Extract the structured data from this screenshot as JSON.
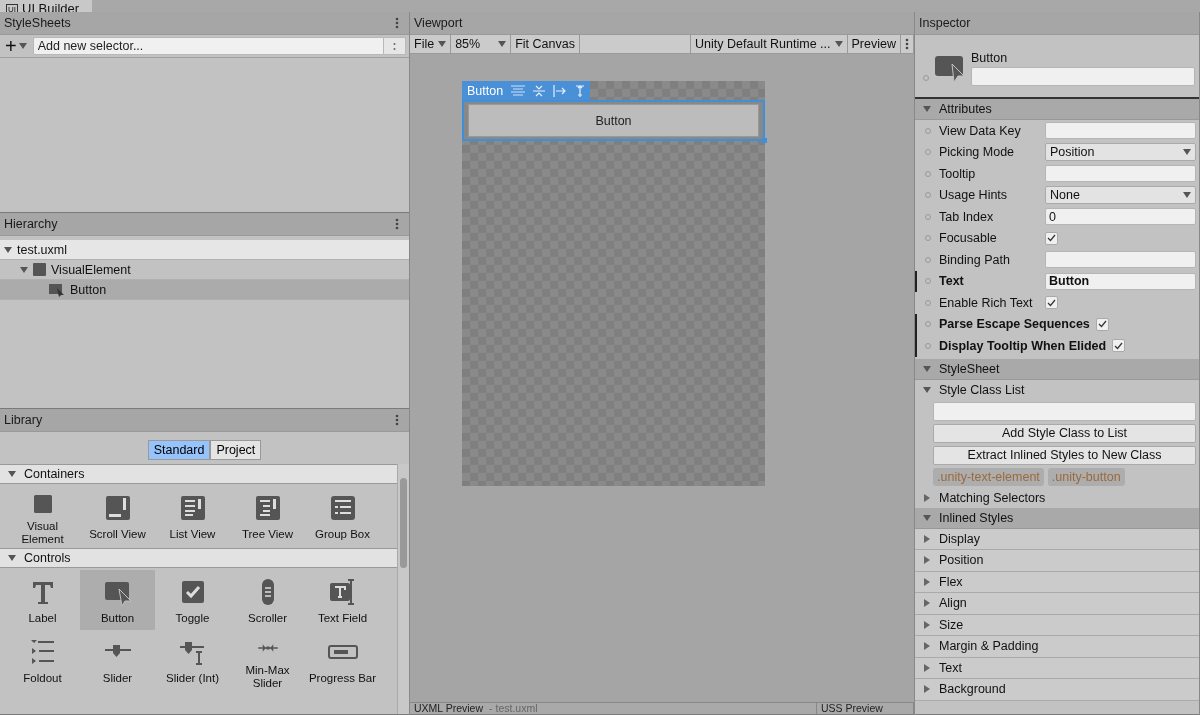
{
  "window": {
    "tab_icon": "UI",
    "title": "UI Builder"
  },
  "stylesheets": {
    "title": "StyleSheets",
    "add_button": "+",
    "selector_field": {
      "placeholder": "Add new selector..."
    }
  },
  "hierarchy": {
    "title": "Hierarchy",
    "items": [
      {
        "label": "test.uxml",
        "kind": "document",
        "expanded": true,
        "selected": false,
        "children": [
          {
            "label": "VisualElement",
            "kind": "element",
            "expanded": true,
            "selected": false,
            "children": [
              {
                "label": "Button",
                "kind": "button",
                "selected": true
              }
            ]
          }
        ]
      }
    ]
  },
  "library": {
    "title": "Library",
    "tabs": [
      {
        "label": "Standard",
        "selected": true
      },
      {
        "label": "Project",
        "selected": false
      }
    ],
    "sections": [
      {
        "title": "Containers",
        "expanded": true,
        "items": [
          {
            "label": "Visual Element",
            "kind": "square",
            "selected": false
          },
          {
            "label": "Scroll View",
            "kind": "scroll",
            "selected": false
          },
          {
            "label": "List View",
            "kind": "list",
            "selected": false
          },
          {
            "label": "Tree View",
            "kind": "tree",
            "selected": false
          },
          {
            "label": "Group Box",
            "kind": "group",
            "selected": false
          }
        ]
      },
      {
        "title": "Controls",
        "expanded": true,
        "items": [
          {
            "label": "Label",
            "kind": "label",
            "selected": false
          },
          {
            "label": "Button",
            "kind": "button",
            "selected": true
          },
          {
            "label": "Toggle",
            "kind": "toggle",
            "selected": false
          },
          {
            "label": "Scroller",
            "kind": "scroller",
            "selected": false
          },
          {
            "label": "Text Field",
            "kind": "textfield",
            "selected": false
          },
          {
            "label": "Foldout",
            "kind": "foldout",
            "selected": false
          },
          {
            "label": "Slider",
            "kind": "slider",
            "selected": false
          },
          {
            "label": "Slider (Int)",
            "kind": "sliderint",
            "selected": false
          },
          {
            "label": "Min-Max Slider",
            "kind": "minmax",
            "selected": false
          },
          {
            "label": "Progress Bar",
            "kind": "progress",
            "selected": false
          }
        ]
      }
    ]
  },
  "viewport": {
    "title": "Viewport",
    "toolbar": [
      {
        "kind": "dropdown",
        "label": "File"
      },
      {
        "kind": "dropdown",
        "label": "85%"
      },
      {
        "kind": "button",
        "label": "Fit Canvas"
      },
      {
        "kind": "spacer"
      },
      {
        "kind": "dropdown",
        "label": "Unity Default Runtime ..."
      },
      {
        "kind": "button",
        "label": "Preview"
      }
    ],
    "selection_label": "Button",
    "canvas_button": "Button"
  },
  "bottom_panels": [
    {
      "title": "UXML Preview",
      "subtitle": "- test.uxml"
    },
    {
      "title": "USS Preview"
    }
  ],
  "inspector": {
    "title": "Inspector",
    "element_type": "Button",
    "attributes": {
      "title": "Attributes",
      "expanded": true,
      "rows": [
        {
          "label": "View Data Key",
          "kind": "text",
          "overridden": false
        },
        {
          "label": "Picking Mode",
          "kind": "dropdown",
          "value": "Position",
          "overridden": false
        },
        {
          "label": "Tooltip",
          "kind": "text",
          "overridden": false
        },
        {
          "label": "Usage Hints",
          "kind": "dropdown",
          "value": "None",
          "overridden": false
        },
        {
          "label": "Tab Index",
          "kind": "text",
          "value": "0",
          "overridden": false
        },
        {
          "label": "Focusable",
          "kind": "checkbox",
          "checked": true,
          "overridden": false
        },
        {
          "label": "Binding Path",
          "kind": "text",
          "overridden": false
        },
        {
          "label": "Text",
          "kind": "text",
          "value": "Button",
          "overridden": true
        },
        {
          "label": "Enable Rich Text",
          "kind": "checkbox",
          "checked": true,
          "overridden": false
        },
        {
          "label": "Parse Escape Sequences",
          "kind": "checkbox",
          "checked": true,
          "overridden": true
        },
        {
          "label": "Display Tooltip When Elided",
          "kind": "checkbox",
          "checked": true,
          "overridden": true
        }
      ]
    },
    "stylesheet": {
      "title": "StyleSheet",
      "expanded": true,
      "class_list": {
        "title": "Style Class List",
        "expanded": true,
        "buttons": [
          "Add Style Class to List",
          "Extract Inlined Styles to New Class"
        ],
        "classes": [
          ".unity-text-element",
          ".unity-button"
        ]
      },
      "matching_selectors": {
        "title": "Matching Selectors",
        "expanded": false
      }
    },
    "inlined_styles": {
      "title": "Inlined Styles",
      "expanded": true,
      "groups": [
        {
          "label": "Display",
          "expanded": false
        },
        {
          "label": "Position",
          "expanded": false
        },
        {
          "label": "Flex",
          "expanded": false
        },
        {
          "label": "Align",
          "expanded": false
        },
        {
          "label": "Size",
          "expanded": false
        },
        {
          "label": "Margin & Padding",
          "expanded": false
        },
        {
          "label": "Text",
          "expanded": false
        },
        {
          "label": "Background",
          "expanded": false
        }
      ]
    }
  }
}
